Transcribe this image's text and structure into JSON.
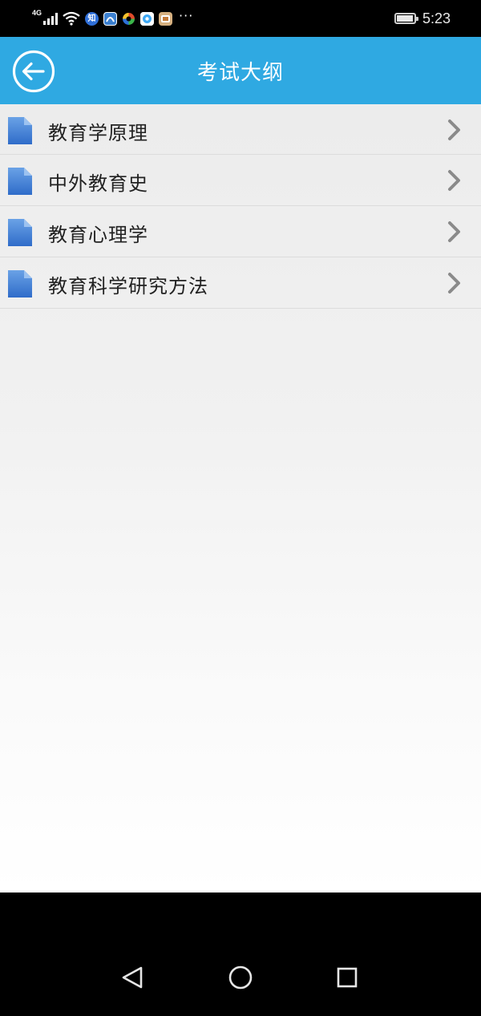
{
  "status_bar": {
    "network_type": "4G",
    "dots": "···",
    "notification_icons": [
      {
        "name": "zhihu-icon",
        "label": "知",
        "color": "#2f6fd8"
      },
      {
        "name": "app-icon-2",
        "label": "",
        "color": "#3a7fd0"
      },
      {
        "name": "app-icon-3",
        "label": "",
        "color": "#e04a2a"
      },
      {
        "name": "app-icon-4",
        "label": "",
        "color": "#3fa9f5"
      },
      {
        "name": "app-icon-5",
        "label": "",
        "color": "#d6b080"
      }
    ],
    "battery_level": 0.85,
    "time": "5:23"
  },
  "header": {
    "title": "考试大纲",
    "back_icon": "arrow-left-circle-icon",
    "background_color": "#2fa9e2"
  },
  "list": {
    "items": [
      {
        "label": "教育学原理",
        "icon": "document-icon"
      },
      {
        "label": "中外教育史",
        "icon": "document-icon"
      },
      {
        "label": "教育心理学",
        "icon": "document-icon"
      },
      {
        "label": "教育科学研究方法",
        "icon": "document-icon"
      }
    ],
    "chevron_icon": "chevron-right-icon"
  },
  "nav_bar": {
    "back_icon": "triangle-back-icon",
    "home_icon": "circle-home-icon",
    "recents_icon": "square-recents-icon"
  }
}
